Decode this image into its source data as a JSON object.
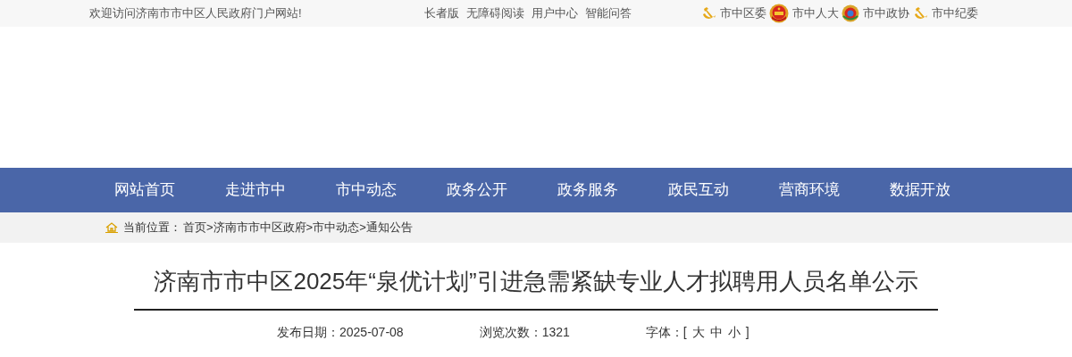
{
  "top_bar": {
    "welcome": "欢迎访问济南市市中区人民政府门户网站!",
    "links": [
      "长者版",
      "无障碍阅读",
      "用户中心",
      "智能问答"
    ],
    "sites": [
      {
        "kind": "party",
        "label": "市中区委"
      },
      {
        "kind": "state",
        "label": "市中人大"
      },
      {
        "kind": "cppcc",
        "label": "市中政协"
      },
      {
        "kind": "party",
        "label": "市中纪委"
      }
    ]
  },
  "nav": [
    "网站首页",
    "走进市中",
    "市中动态",
    "政务公开",
    "政务服务",
    "政民互动",
    "营商环境",
    "数据开放"
  ],
  "breadcrumb": {
    "label": "当前位置：",
    "items": [
      "首页",
      "济南市市中区政府",
      "市中动态",
      "通知公告"
    ],
    "separator": ">"
  },
  "article": {
    "title": "济南市市中区2025年“泉优计划”引进急需紧缺专业人才拟聘用人员名单公示",
    "date": "发布日期：2025-07-08",
    "views": "浏览次数：1321",
    "font_size": {
      "label": "字体：",
      "open": "[",
      "options": [
        "大",
        "中",
        "小"
      ],
      "close": "]"
    }
  }
}
